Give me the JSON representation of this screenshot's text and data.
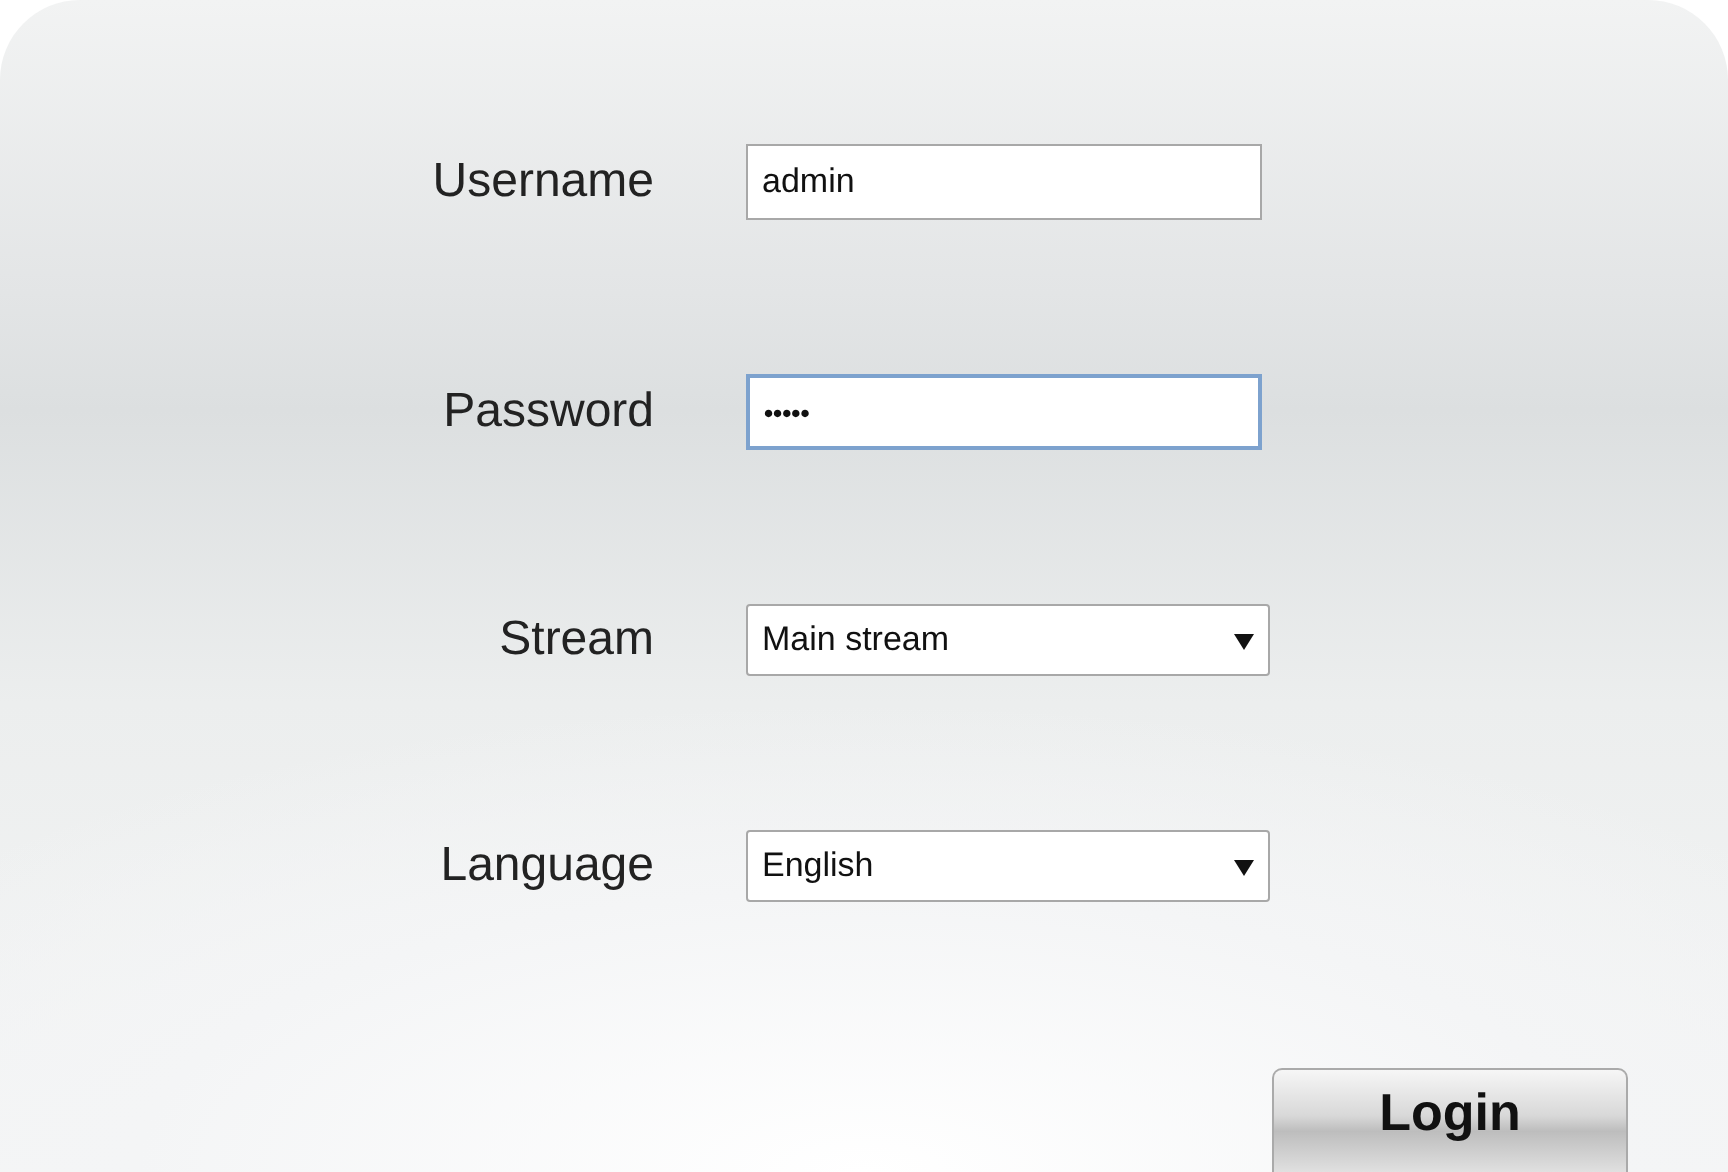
{
  "fields": [
    {
      "label": "Username",
      "kind": "text",
      "value": "admin",
      "focused": false
    },
    {
      "label": "Password",
      "kind": "password",
      "value": "•••••",
      "focused": true
    },
    {
      "label": "Stream",
      "kind": "select",
      "value": "Main stream",
      "focused": false
    },
    {
      "label": "Language",
      "kind": "select",
      "value": "English",
      "focused": false
    }
  ],
  "login_button": {
    "label": "Login"
  }
}
